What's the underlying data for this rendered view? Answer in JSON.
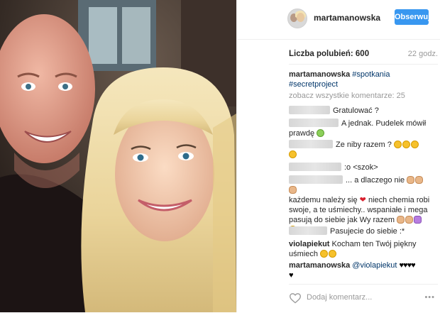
{
  "post": {
    "photo_alt": "selfie",
    "username": "martamanowska",
    "follow_label": "Obserwuj",
    "likes_text": "Liczba polubień: 600",
    "time_ago": "22 godz.",
    "caption_user": "martamanowska",
    "caption_tags": [
      "#spotkania",
      "#secretproject"
    ],
    "view_all_comments": "zobacz wszystkie komentarze: 25"
  },
  "comments": [
    {
      "user": "",
      "text": "Gratulować ?"
    },
    {
      "user": "",
      "text": "A jednak. Pudelek mówił prawdę"
    },
    {
      "user": "",
      "text": "Ze niby razem ?"
    },
    {
      "user": "",
      "text": ":o <szok>"
    },
    {
      "user": "",
      "text": "... a dlaczego nie"
    },
    {
      "user": "",
      "text": "każdemu należy się"
    },
    {
      "user": "",
      "text": "niech chemia robi swoje, a te uśmiechy.. wspaniałe i mega pasują do siebie jak Wy razem"
    },
    {
      "user": "",
      "text": "Pasujecie do siebie :*"
    },
    {
      "user": "violapiekut",
      "text": "Kocham ten Twój piękny uśmiech"
    },
    {
      "user": "martamanowska",
      "mention": "@violapiekut",
      "text": ""
    }
  ],
  "footer": {
    "add_comment_placeholder": "Dodaj komentarz...",
    "more_label": "•••"
  },
  "icons": {
    "like": "heart-outline-icon",
    "more": "more-dots-icon"
  },
  "colors": {
    "accent": "#3897f0",
    "hashtag": "#003569",
    "muted": "#999999"
  }
}
